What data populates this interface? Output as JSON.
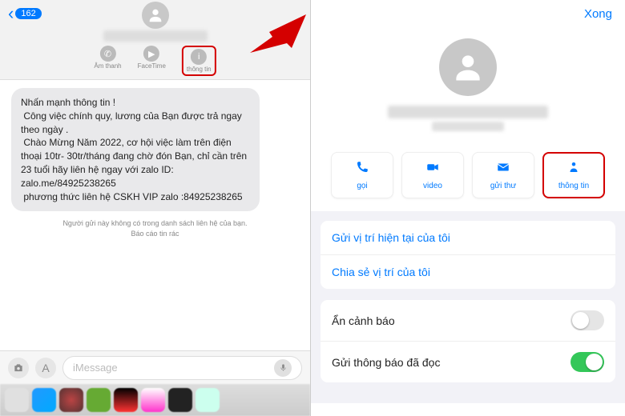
{
  "left": {
    "back_badge": "162",
    "actions": [
      {
        "label": "Âm thanh",
        "icon": "phone"
      },
      {
        "label": "FaceTime",
        "icon": "video"
      },
      {
        "label": "thông tin",
        "icon": "info"
      }
    ],
    "message": "Nhấn mạnh thông tin !\n Công việc chính quy, lương của Bạn được trả ngay theo ngày .\n Chào Mừng Năm 2022, cơ hội việc làm trên điện thoại 10tr- 30tr/tháng đang chờ đón Bạn, chỉ cần trên 23 tuổi hãy liên hệ ngay với zalo ID: zalo.me/84925238265\n phương thức liên hệ CSKH VIP zalo :84925238265",
    "notice": "Người gửi này không có trong danh sách liên hệ của bạn.",
    "report": "Báo cáo tin rác",
    "input_placeholder": "iMessage"
  },
  "right": {
    "done": "Xong",
    "actions": [
      {
        "label": "gọi",
        "icon": "phone"
      },
      {
        "label": "video",
        "icon": "video"
      },
      {
        "label": "gửi thư",
        "icon": "mail"
      },
      {
        "label": "thông tin",
        "icon": "person"
      }
    ],
    "links": {
      "send_current": "Gửi vị trí hiện tại của tôi",
      "share_loc": "Chia sẻ vị trí của tôi"
    },
    "settings": {
      "hide_alerts": "Ẩn cảnh báo",
      "read_receipts": "Gửi thông báo đã đọc"
    },
    "toggles": {
      "hide_alerts": false,
      "read_receipts": true
    }
  }
}
